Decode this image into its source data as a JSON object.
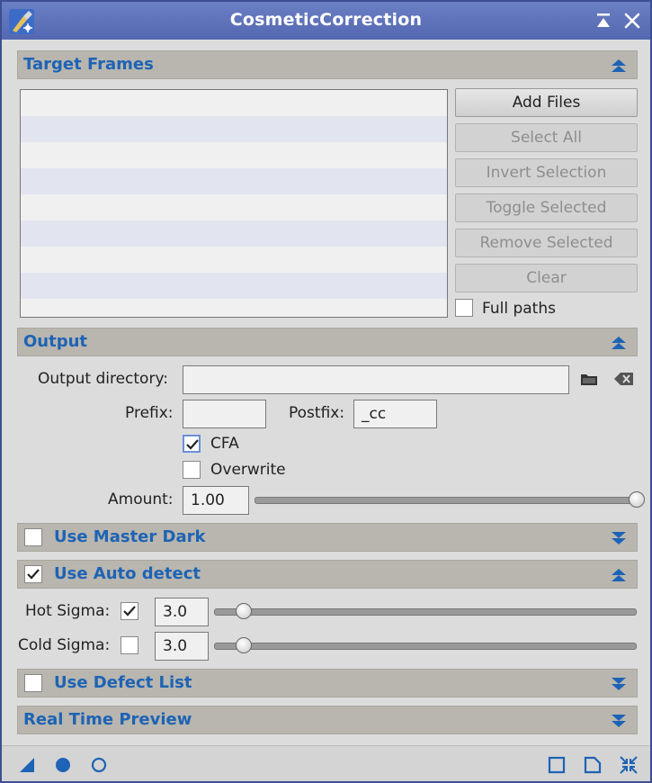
{
  "window": {
    "title": "CosmeticCorrection",
    "icons": {
      "app": "brush-icon",
      "shade": "shade-icon",
      "close": "close-icon"
    }
  },
  "target_frames": {
    "title": "Target Frames",
    "collapse_icon": "collapse-up-icon",
    "rows": 8,
    "buttons": {
      "add_files": "Add Files",
      "select_all": "Select All",
      "invert_selection": "Invert Selection",
      "toggle_selected": "Toggle Selected",
      "remove_selected": "Remove Selected",
      "clear": "Clear"
    },
    "full_paths_label": "Full paths",
    "full_paths_checked": false
  },
  "output": {
    "title": "Output",
    "collapse_icon": "collapse-up-icon",
    "directory_label": "Output directory:",
    "directory_value": "",
    "folder_icon": "folder-icon",
    "clear_icon": "backspace-clear-icon",
    "prefix_label": "Prefix:",
    "prefix_value": "",
    "postfix_label": "Postfix:",
    "postfix_value": "_cc",
    "cfa_label": "CFA",
    "cfa_checked": true,
    "overwrite_label": "Overwrite",
    "overwrite_checked": false,
    "amount_label": "Amount:",
    "amount_value": "1.00",
    "amount_fraction": 1.0
  },
  "master_dark": {
    "title": "Use Master Dark",
    "checked": false,
    "expand_icon": "expand-down-icon"
  },
  "auto_detect": {
    "title": "Use Auto detect",
    "checked": true,
    "collapse_icon": "collapse-up-icon",
    "hot_label": "Hot Sigma:",
    "hot_checked": true,
    "hot_value": "3.0",
    "hot_fraction": 0.07,
    "cold_label": "Cold Sigma:",
    "cold_checked": false,
    "cold_value": "3.0",
    "cold_fraction": 0.07
  },
  "defect_list": {
    "title": "Use Defect List",
    "checked": false,
    "expand_icon": "expand-down-icon"
  },
  "realtime_preview": {
    "title": "Real Time Preview",
    "expand_icon": "expand-down-icon"
  },
  "bottom_bar": {
    "left_icons": [
      "new-instance-triangle-icon",
      "apply-global-circle-icon",
      "real-time-preview-circle-icon"
    ],
    "right_icons": [
      "browse-documentation-square-icon",
      "reset-document-icon",
      "shrink-arrows-icon"
    ]
  },
  "colors": {
    "titlebar": "#5a6eb8",
    "section_bar": "#b8b6ae",
    "section_title": "#1e63b5",
    "accent_icon": "#1e63b5"
  }
}
